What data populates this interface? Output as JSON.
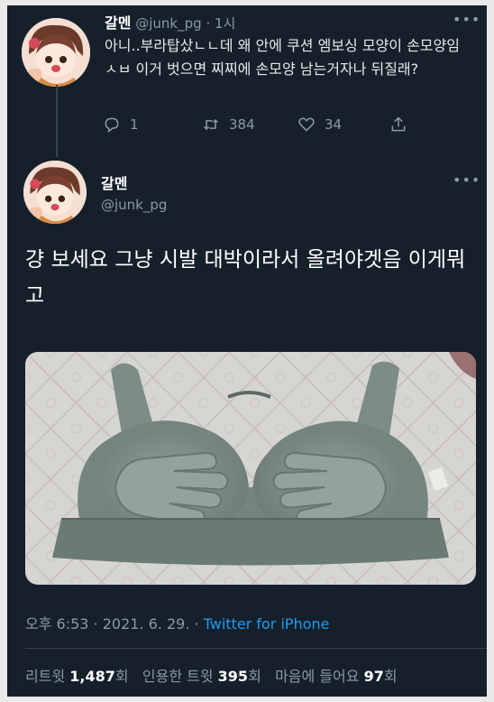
{
  "reply_tweet": {
    "author_name": "갈멘",
    "author_handle": "@junk_pg",
    "time_ago": "1시",
    "text": "아니..부라탑샀ㄴㄴ데 왜 안에 쿠션 엠보싱 모양이 손모양임 ㅅㅂ 이거 벗으면 찌찌에 손모양 남는거자나 뒤질래?",
    "actions": {
      "reply_count": "1",
      "retweet_count": "384",
      "like_count": "34"
    }
  },
  "main_tweet": {
    "author_name": "갈멘",
    "author_handle": "@junk_pg",
    "text": "걍 보세요 그냥 시발 대박이라서 올려야겟음 이게뭐고",
    "timestamp": "오후 6:53 · 2021. 6. 29.",
    "source": "Twitter for iPhone",
    "stats": {
      "retweets_label": "리트윗",
      "retweets_value": "1,487",
      "retweets_unit": "회",
      "quotes_label": "인용한 트윗",
      "quotes_value": "395",
      "quotes_unit": "회",
      "likes_label": "마음에 들어요",
      "likes_value": "97",
      "likes_unit": "회"
    }
  },
  "colors": {
    "background": "#15202b",
    "text_primary": "#e7e9ea",
    "text_secondary": "#8b98a5",
    "accent": "#1d9bf0"
  },
  "icons": [
    "more-icon",
    "reply-icon",
    "retweet-icon",
    "like-icon",
    "share-icon"
  ]
}
